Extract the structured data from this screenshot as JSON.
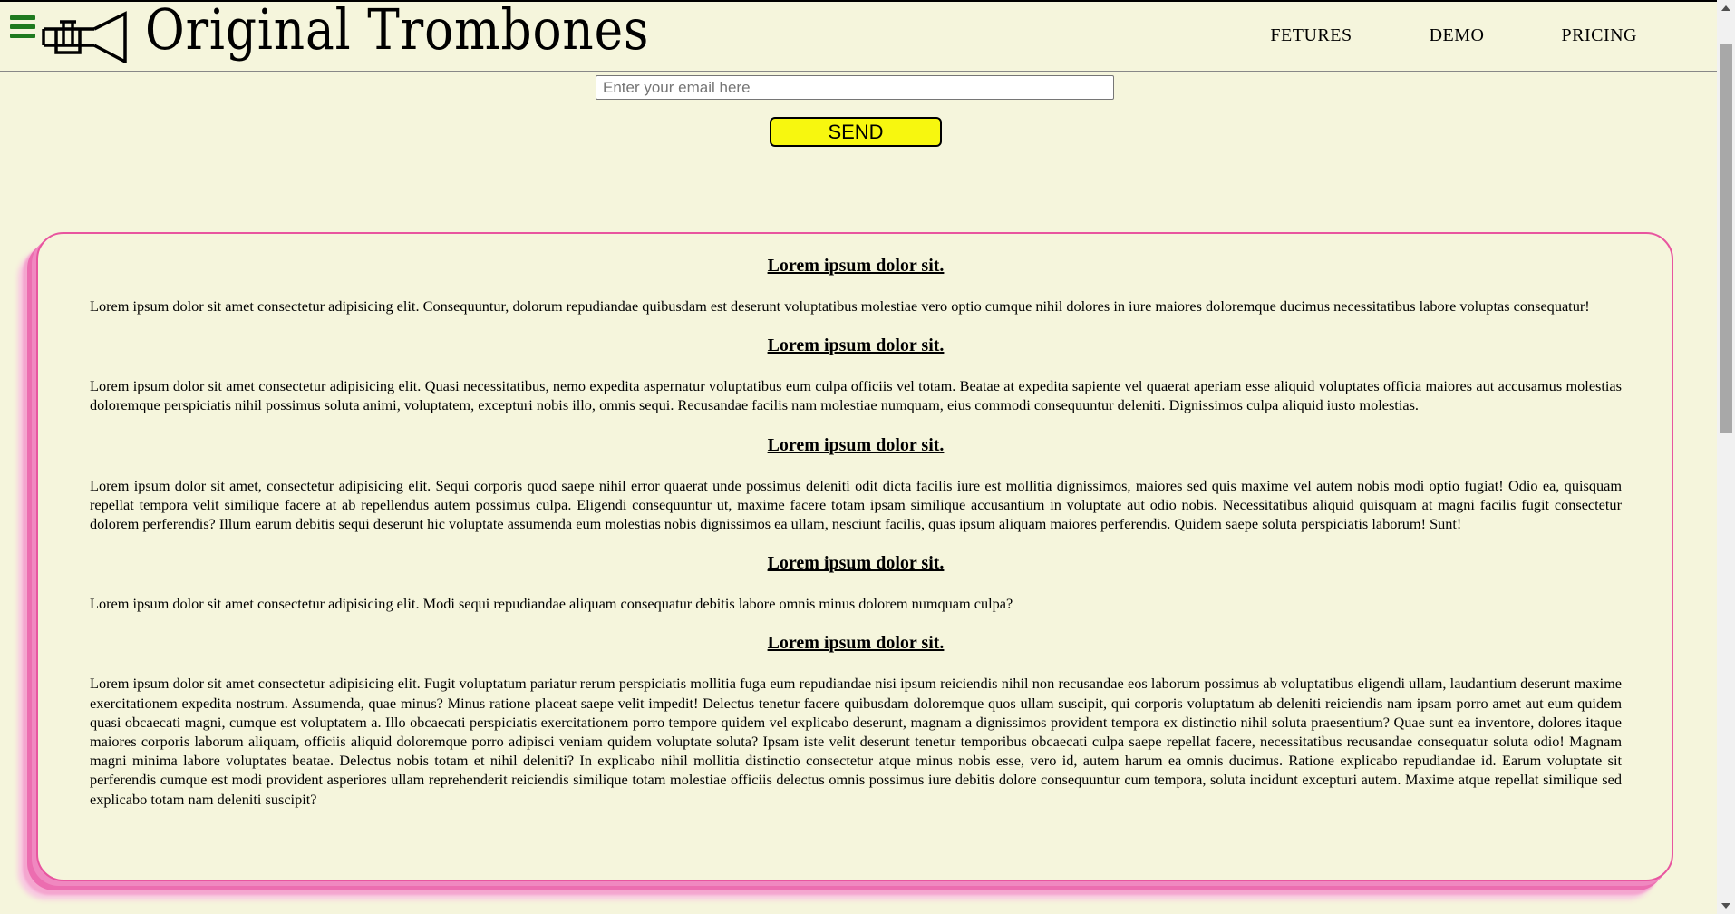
{
  "header": {
    "brand": "Original Trombones",
    "nav": [
      "FETURES",
      "DEMO",
      "PRICING"
    ]
  },
  "form": {
    "email_placeholder": "Enter your email here",
    "email_value": "",
    "send_label": "SEND"
  },
  "sections": [
    {
      "title": "Lorem ipsum dolor sit.",
      "text": "Lorem ipsum dolor sit amet consectetur adipisicing elit. Consequuntur, dolorum repudiandae quibusdam est deserunt voluptatibus molestiae vero optio cumque nihil dolores in iure maiores doloremque ducimus necessitatibus labore voluptas consequatur!"
    },
    {
      "title": "Lorem ipsum dolor sit.",
      "text": "Lorem ipsum dolor sit amet consectetur adipisicing elit. Quasi necessitatibus, nemo expedita aspernatur voluptatibus eum culpa officiis vel totam. Beatae at expedita sapiente vel quaerat aperiam esse aliquid voluptates officia maiores aut accusamus molestias doloremque perspiciatis nihil possimus soluta animi, voluptatem, excepturi nobis illo, omnis sequi. Recusandae facilis nam molestiae numquam, eius commodi consequuntur deleniti. Dignissimos culpa aliquid iusto molestias."
    },
    {
      "title": "Lorem ipsum dolor sit.",
      "text": "Lorem ipsum dolor sit amet, consectetur adipisicing elit. Sequi corporis quod saepe nihil error quaerat unde possimus deleniti odit dicta facilis iure est mollitia dignissimos, maiores sed quis maxime vel autem nobis modi optio fugiat! Odio ea, quisquam repellat tempora velit similique facere at ab repellendus autem possimus culpa. Eligendi consequuntur ut, maxime facere totam ipsam similique accusantium in voluptate aut odio nobis. Necessitatibus aliquid quisquam at magni facilis fugit consectetur dolorem perferendis? Illum earum debitis sequi deserunt hic voluptate assumenda eum molestias nobis dignissimos ea ullam, nesciunt facilis, quas ipsum aliquam maiores perferendis. Quidem saepe soluta perspiciatis laborum! Sunt!"
    },
    {
      "title": "Lorem ipsum dolor sit.",
      "text": "Lorem ipsum dolor sit amet consectetur adipisicing elit. Modi sequi repudiandae aliquam consequatur debitis labore omnis minus dolorem numquam culpa?"
    },
    {
      "title": "Lorem ipsum dolor sit.",
      "text": "Lorem ipsum dolor sit amet consectetur adipisicing elit. Fugit voluptatum pariatur rerum perspiciatis mollitia fuga eum repudiandae nisi ipsum reiciendis nihil non recusandae eos laborum possimus ab voluptatibus eligendi ullam, laudantium deserunt maxime exercitationem expedita nostrum. Assumenda, quae minus? Minus ratione placeat saepe velit impedit! Delectus tenetur facere quibusdam doloremque quos ullam suscipit, qui corporis voluptatum ab deleniti reiciendis nam ipsam porro amet aut eum quidem quasi obcaecati magni, cumque est voluptatem a. Illo obcaecati perspiciatis exercitationem porro tempore quidem vel explicabo deserunt, magnam a dignissimos provident tempora ex distinctio nihil soluta praesentium? Quae sunt ea inventore, dolores itaque maiores corporis laborum aliquam, officiis aliquid doloremque porro adipisci veniam quidem voluptate soluta? Ipsam iste velit deserunt tenetur temporibus obcaecati culpa saepe repellat facere, necessitatibus recusandae consequatur soluta odio! Magnam magni minima labore voluptates beatae. Delectus nobis totam et nihil deleniti? In explicabo nihil mollitia distinctio consectetur atque minus nobis esse, vero id, autem harum ea omnis ducimus. Ratione explicabo repudiandae id. Earum voluptate sit perferendis cumque est modi provident asperiores ullam reprehenderit reiciendis similique totam molestiae officiis delectus omnis possimus iure debitis dolore consequuntur cum tempora, soluta incidunt excepturi autem. Maxime atque repellat similique sed explicabo totam nam deleniti suscipit?"
    }
  ],
  "colors": {
    "background": "#f5f5dc",
    "accent_pink": "#e8559f",
    "send_button": "#f7f70f",
    "hamburger": "#1f7a1f"
  },
  "icons": [
    "hamburger-menu-icon",
    "trumpet-logo-icon"
  ]
}
